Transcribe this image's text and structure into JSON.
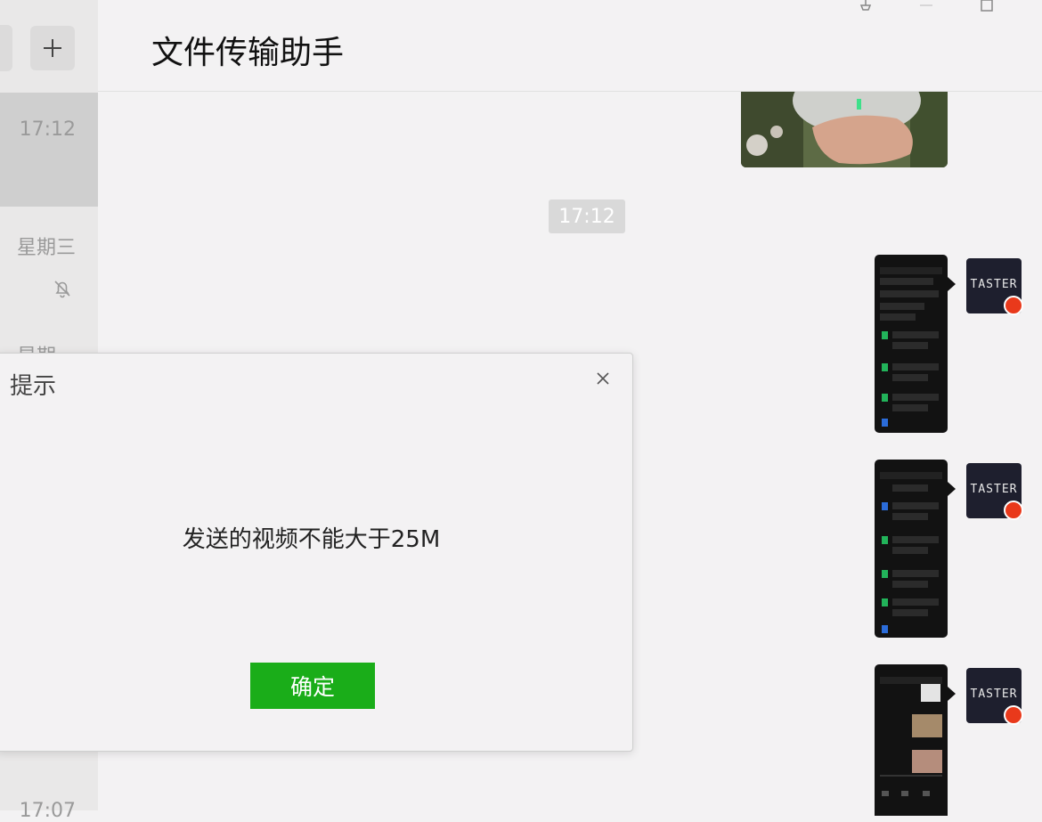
{
  "sidebar": {
    "times": [
      "17:12",
      "星期三",
      "星期一",
      "17:07"
    ]
  },
  "header": {
    "title": "文件传输助手"
  },
  "chat": {
    "timestamp": "17:12",
    "avatar_text": "TASTER"
  },
  "dialog": {
    "title": "提示",
    "message": "发送的视频不能大于25M",
    "ok_label": "确定"
  },
  "colors": {
    "accent_green": "#1aad19",
    "badge_red": "#e9391b",
    "avatar_bg": "#1e1f2e"
  }
}
